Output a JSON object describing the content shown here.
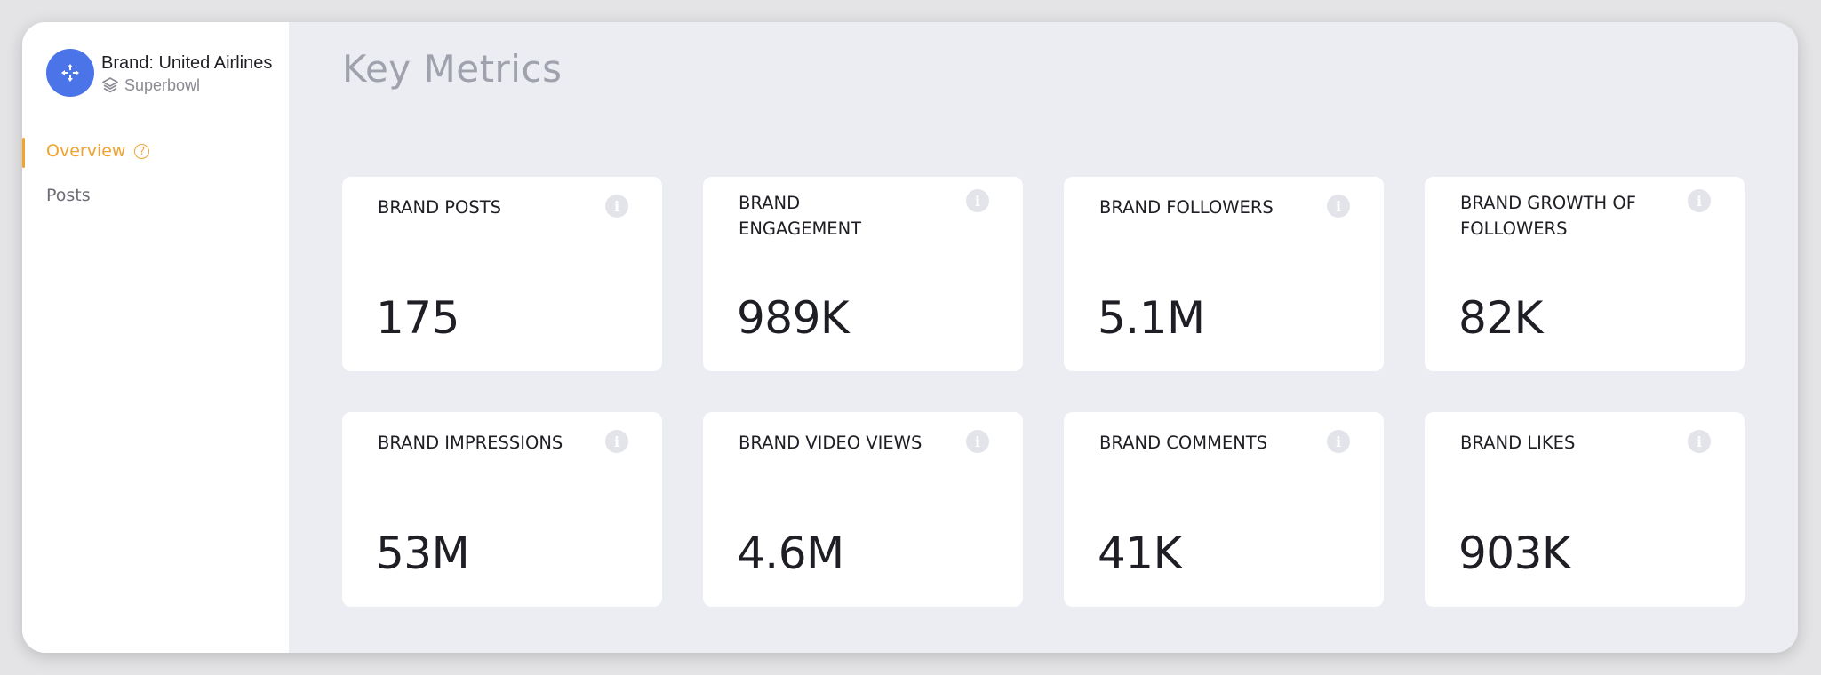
{
  "sidebar": {
    "brand_name": "Brand: United Airlines",
    "campaign": "Superbowl",
    "brand_icon": "crosshair-move-icon",
    "campaign_icon": "layers-icon",
    "nav": [
      {
        "label": "Overview",
        "active": true,
        "help_icon": "?"
      },
      {
        "label": "Posts",
        "active": false
      }
    ]
  },
  "main": {
    "title": "Key Metrics",
    "metrics": [
      {
        "label": "BRAND POSTS",
        "value": "175"
      },
      {
        "label": "BRAND ENGAGEMENT",
        "value": "989K"
      },
      {
        "label": "BRAND FOLLOWERS",
        "value": "5.1M"
      },
      {
        "label": "BRAND GROWTH OF FOLLOWERS",
        "value": "82K"
      },
      {
        "label": "BRAND IMPRESSIONS",
        "value": "53M"
      },
      {
        "label": "BRAND VIDEO VIEWS",
        "value": "4.6M"
      },
      {
        "label": "BRAND COMMENTS",
        "value": "41K"
      },
      {
        "label": "BRAND LIKES",
        "value": "903K"
      }
    ],
    "info_glyph": "i"
  },
  "colors": {
    "accent": "#f0a32f",
    "brand_avatar": "#4a74e8",
    "background": "#ecedf2",
    "card": "#ffffff"
  }
}
